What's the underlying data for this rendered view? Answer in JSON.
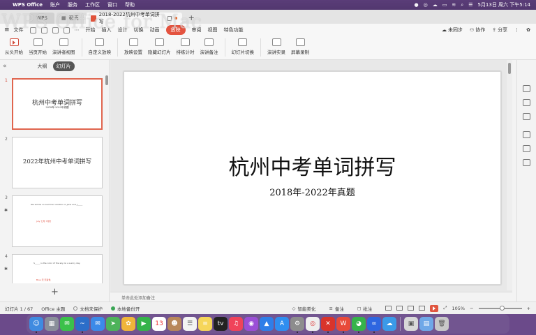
{
  "menubar": {
    "app_name": "WPS Office",
    "items": [
      "账户",
      "服务",
      "工作区",
      "窗口",
      "帮助"
    ],
    "clock": "5月13日 周六 下午5:14"
  },
  "watermark": "WPS Office for Mac",
  "tabs": {
    "wps": "WPS",
    "daoke": "稻壳",
    "doc": "2018-2022杭州中考单词拼写"
  },
  "menu": {
    "items": [
      "文件",
      "开始",
      "插入",
      "设计",
      "切换",
      "动画",
      "放映",
      "审阅",
      "视图",
      "特色功能"
    ],
    "active": "放映",
    "sync": "未同步",
    "collab": "协作",
    "share": "分享"
  },
  "ribbon": {
    "buttons": [
      "从头开始",
      "当页开始",
      "演讲者视图",
      "自定义放映",
      "放映设置",
      "隐藏幻灯片",
      "排练计时",
      "演讲备注",
      "幻灯片切换",
      "演讲实录",
      "屏幕录制"
    ]
  },
  "left_panel": {
    "tab_outline": "大纲",
    "tab_slides": "幻灯片",
    "thumbnails": [
      {
        "num": "1",
        "title": "杭州中考单词拼写",
        "sub": "2018年-2022年真题"
      },
      {
        "num": "2",
        "title": "2022年杭州中考单词拼写"
      },
      {
        "num": "3",
        "line": "We will be on summer vacation in June and J_____",
        "red": "July   七月  7月份"
      },
      {
        "num": "4",
        "line": "S_____ is the color of the sky on a sunny day.",
        "red": "Blue  天  天蓝色"
      }
    ],
    "add": "+"
  },
  "slide": {
    "title": "杭州中考单词拼写",
    "subtitle": "2018年-2022年真题"
  },
  "notes_placeholder": "单击此处添加备注",
  "status": {
    "slide_counter": "幻灯片 1 / 67",
    "theme": "Office 主题",
    "unprotected": "文档未保护",
    "local_backup": "本地备份开",
    "beautify": "智能美化",
    "notes": "备注",
    "comment": "批注",
    "zoom": "105%"
  },
  "dock_apps": [
    "finder-icon",
    "launchpad-icon",
    "messages-icon",
    "app4-icon",
    "mail-icon",
    "maps-icon",
    "photos-icon",
    "facetime-icon",
    "calendar-icon",
    "contacts-icon",
    "reminders-icon",
    "notes-icon",
    "tv-icon",
    "music-icon",
    "podcasts-icon",
    "keynote-icon",
    "appstore-icon",
    "settings-icon",
    "chrome-icon",
    "app-x-icon",
    "wps-icon",
    "wechat-icon",
    "baidu-icon",
    "app-cloud-icon",
    "preview-icon",
    "folder-icon",
    "trash-icon"
  ],
  "colors": {
    "accent": "#e4533f",
    "thumb_selected_border": "#e0654e"
  }
}
